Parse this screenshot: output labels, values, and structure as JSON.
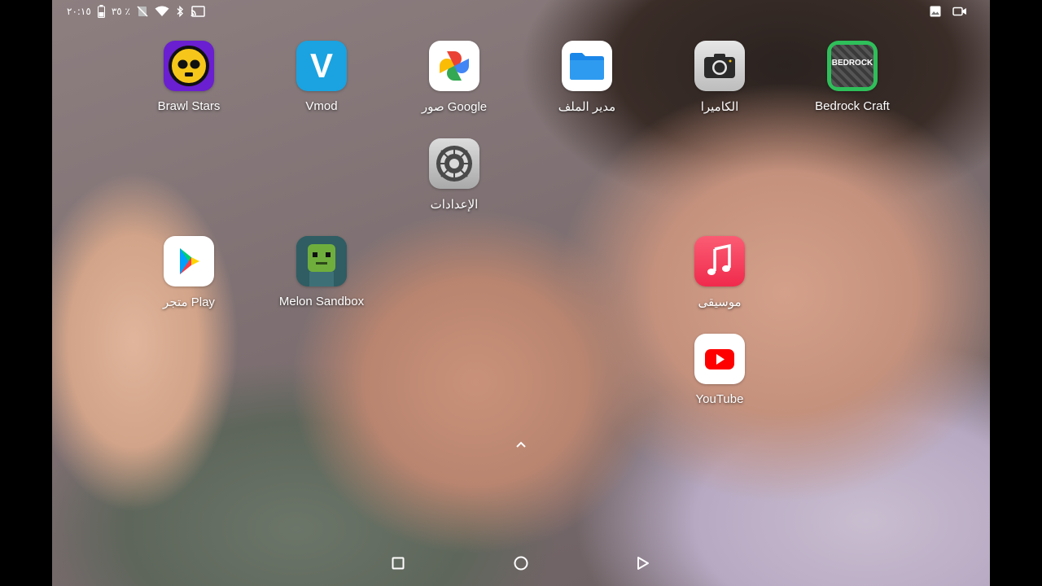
{
  "status_bar": {
    "time": "٢٠:١٥",
    "battery_percent": "٣٥ ٪",
    "left_icons": [
      "battery-icon",
      "silent-icon",
      "wifi-icon",
      "bluetooth-icon",
      "cast-icon"
    ],
    "right_icons": [
      "image-icon",
      "video-record-icon"
    ]
  },
  "apps": [
    {
      "label": "Brawl Stars",
      "icon": "brawl-stars-icon",
      "color": "#6a1fd0"
    },
    {
      "label": "Vmod",
      "icon": "vmod-icon",
      "color": "#1aa3e0"
    },
    {
      "label": "صور Google",
      "icon": "google-photos-icon",
      "color": "#ffffff"
    },
    {
      "label": "مدير الملف",
      "icon": "files-icon",
      "color": "#ffffff"
    },
    {
      "label": "الكاميرا",
      "icon": "camera-icon",
      "color": "#d8d8d8"
    },
    {
      "label": "Bedrock Craft",
      "icon": "bedrock-craft-icon",
      "color": "#2fbf5a"
    },
    {
      "label": "الإعدادات",
      "icon": "settings-icon",
      "color": "#cfcfcf"
    },
    {
      "label": "متجر Play",
      "icon": "play-store-icon",
      "color": "#ffffff"
    },
    {
      "label": "Melon Sandbox",
      "icon": "melon-sandbox-icon",
      "color": "#2d5a5e"
    },
    {
      "label": "موسيقى",
      "icon": "music-icon",
      "color": "#f2385a"
    },
    {
      "label": "YouTube",
      "icon": "youtube-icon",
      "color": "#ffffff"
    }
  ],
  "bedrock_text": "BEDROCK",
  "vmod_letter": "V",
  "nav": {
    "buttons": [
      "recents-button",
      "home-button",
      "back-button"
    ],
    "drawer_handle": "app-drawer-chevron-up-icon"
  }
}
